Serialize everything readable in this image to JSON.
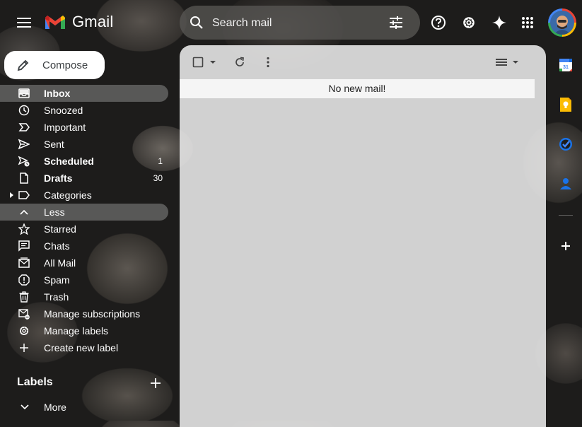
{
  "app": {
    "name": "Gmail"
  },
  "search": {
    "placeholder": "Search mail"
  },
  "compose": {
    "label": "Compose"
  },
  "nav": [
    {
      "label": "Inbox",
      "count": "",
      "bold": true,
      "active": true,
      "icon": "inbox-icon"
    },
    {
      "label": "Snoozed",
      "count": "",
      "icon": "clock-icon"
    },
    {
      "label": "Important",
      "count": "",
      "icon": "label-important-icon"
    },
    {
      "label": "Sent",
      "count": "",
      "icon": "send-icon"
    },
    {
      "label": "Scheduled",
      "count": "1",
      "bold": true,
      "icon": "scheduled-send-icon"
    },
    {
      "label": "Drafts",
      "count": "30",
      "bold": true,
      "icon": "draft-icon"
    },
    {
      "label": "Categories",
      "count": "",
      "icon": "label-icon"
    },
    {
      "label": "Less",
      "count": "",
      "active": true,
      "icon": "chevron-up-icon"
    },
    {
      "label": "Starred",
      "count": "",
      "icon": "star-icon"
    },
    {
      "label": "Chats",
      "count": "",
      "icon": "chat-icon"
    },
    {
      "label": "All Mail",
      "count": "",
      "icon": "all-mail-icon"
    },
    {
      "label": "Spam",
      "count": "",
      "icon": "spam-icon"
    },
    {
      "label": "Trash",
      "count": "",
      "icon": "trash-icon"
    },
    {
      "label": "Manage subscriptions",
      "count": "",
      "icon": "unsubscribe-icon"
    },
    {
      "label": "Manage labels",
      "count": "",
      "icon": "gear-icon"
    },
    {
      "label": "Create new label",
      "count": "",
      "icon": "plus-icon"
    }
  ],
  "labels": {
    "heading": "Labels",
    "more": "More"
  },
  "main": {
    "empty_message": "No new mail!"
  },
  "colors": {
    "gmail_red": "#ea4335",
    "gmail_blue": "#4285f4",
    "gmail_green": "#34a853",
    "gmail_yellow": "#fbbc04"
  }
}
